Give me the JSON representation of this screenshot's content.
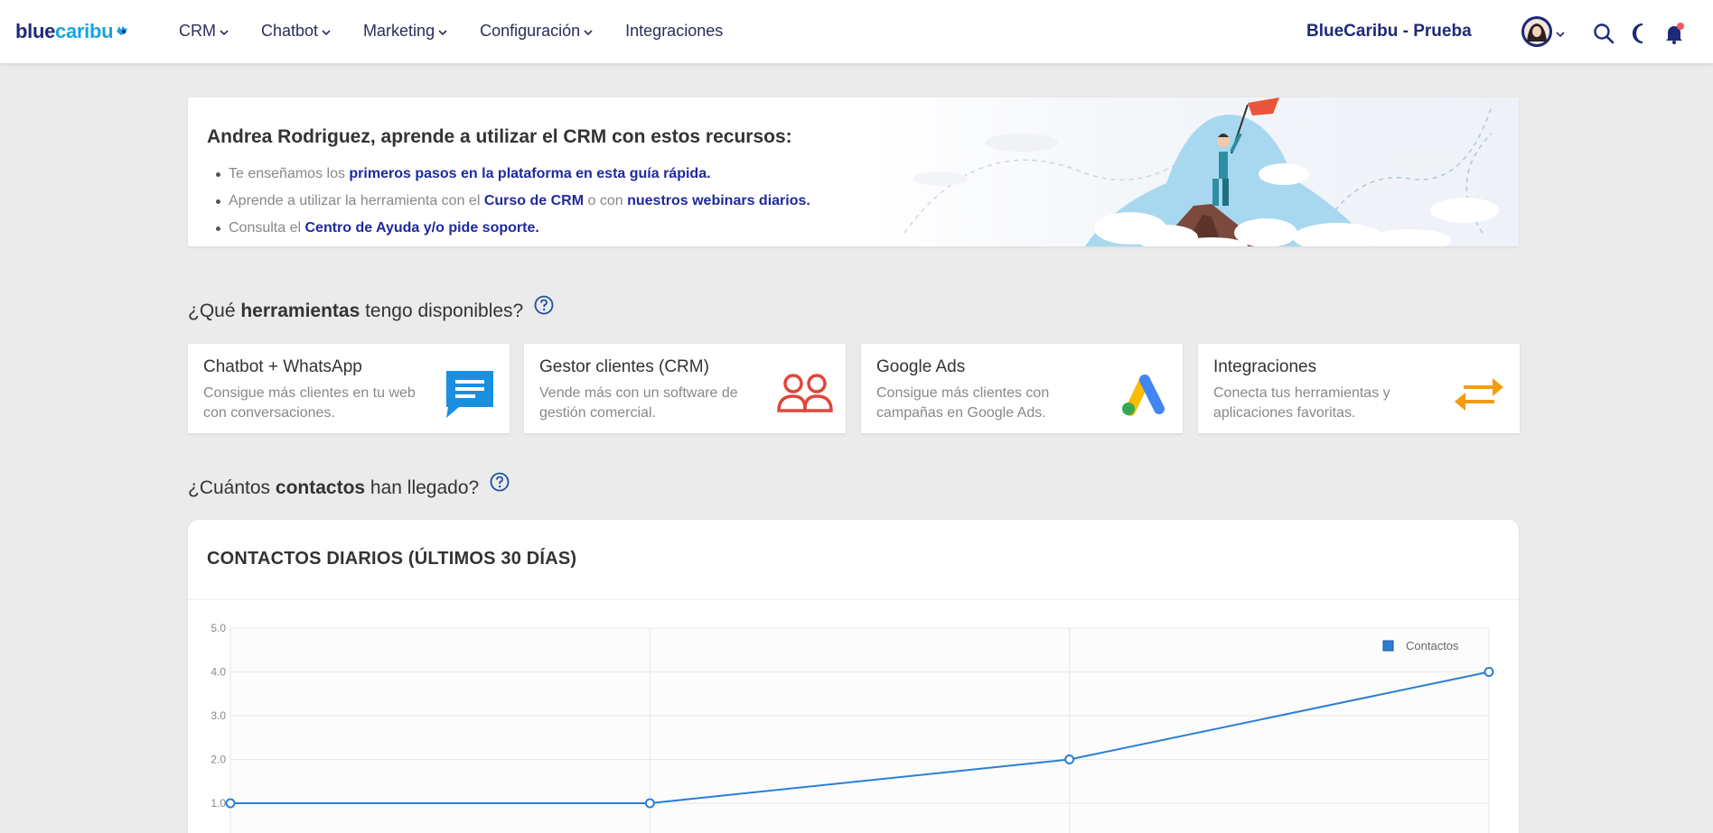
{
  "navbar": {
    "logo_part1": "blue",
    "logo_part2": "caribu",
    "menu": [
      {
        "label": "CRM",
        "has_dropdown": true
      },
      {
        "label": "Chatbot",
        "has_dropdown": true
      },
      {
        "label": "Marketing",
        "has_dropdown": true
      },
      {
        "label": "Configuración",
        "has_dropdown": true
      },
      {
        "label": "Integraciones",
        "has_dropdown": false
      }
    ],
    "account_name": "BlueCaribu - Prueba",
    "icons": [
      "search-icon",
      "moon-icon",
      "bell-icon"
    ]
  },
  "banner": {
    "title": "Andrea Rodriguez, aprende a utilizar el CRM con estos recursos:",
    "items": [
      {
        "pre": "Te enseñamos los ",
        "link1": "primeros pasos en la plataforma en esta guía rápida.",
        "mid": "",
        "link2": ""
      },
      {
        "pre": "Aprende a utilizar la herramienta con el ",
        "link1": "Curso de CRM",
        "mid": " o con ",
        "link2": "nuestros webinars diarios."
      },
      {
        "pre": "Consulta el ",
        "link1": "Centro de Ayuda y/o pide soporte.",
        "mid": "",
        "link2": ""
      }
    ]
  },
  "tools_section": {
    "heading_pre": "¿Qué ",
    "heading_bold": "herramientas",
    "heading_post": " tengo disponibles?"
  },
  "tools": [
    {
      "title": "Chatbot + WhatsApp",
      "desc": "Consigue más clientes en tu web con conversaciones.",
      "icon": "chat-bubble-icon",
      "color": "#1a8fe0"
    },
    {
      "title": "Gestor clientes (CRM)",
      "desc": "Vende más con un software de gestión comercial.",
      "icon": "users-icon",
      "color": "#e0463a"
    },
    {
      "title": "Google Ads",
      "desc": "Consigue más clientes con campañas en Google Ads.",
      "icon": "google-ads-icon",
      "color": "#4285f4"
    },
    {
      "title": "Integraciones",
      "desc": "Conecta tus herramientas y aplicaciones favoritas.",
      "icon": "arrows-exchange-icon",
      "color": "#f39c12"
    }
  ],
  "contacts_section": {
    "heading_pre": "¿Cuántos ",
    "heading_bold": "contactos",
    "heading_post": " han llegado?"
  },
  "chart_data": {
    "type": "line",
    "title": "CONTACTOS DIARIOS (ÚLTIMOS 30 DÍAS)",
    "series": [
      {
        "name": "Contactos",
        "values": [
          1,
          1,
          2,
          4
        ],
        "color": "#2a7fd4"
      }
    ],
    "yticks": [
      "5.0",
      "4.0",
      "3.0",
      "2.0",
      "1.0"
    ],
    "ylim": [
      0,
      5
    ],
    "grid": true,
    "legend": "top-right"
  }
}
